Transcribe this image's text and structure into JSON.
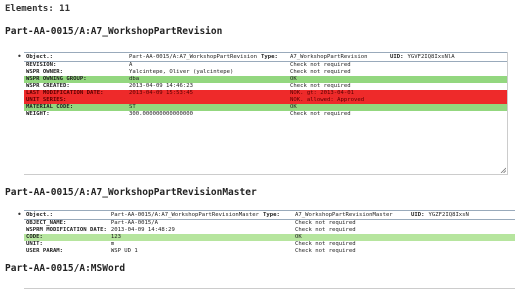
{
  "header": {
    "elements_label": "Elements: 11"
  },
  "sections": [
    {
      "title": "Part-AA-0015/A:A7_WorkshopPartRevision",
      "header_row": {
        "key": "Object.:",
        "value": "Part-AA-0015/A:A7_WorkshopPartRevision",
        "type_label": "Type:",
        "type_value": "A7_WorkshopPartRevision",
        "uid_label": "UID:",
        "uid_value": "YGVF2IQ8IxsNlA"
      },
      "rows": [
        {
          "key": "REVISION:",
          "value": "A",
          "status": "Check not required",
          "color": ""
        },
        {
          "key": "WSPR OWNER:",
          "value": "Yalcintepe, Oliver (yalcintepe)",
          "status": "Check not required",
          "color": ""
        },
        {
          "key": "WSPR OWNING GROUP:",
          "value": "dba",
          "status": "OK",
          "color": "green"
        },
        {
          "key": "WSPR CREATED:",
          "value": "2013-04-09 14:46:23",
          "status": "Check not required",
          "color": ""
        },
        {
          "key": "LAST MODIFICATION DATE:",
          "value": "2013-04-09 15:53:45",
          "status": "NOK. gt: 2013-04-01",
          "color": "red"
        },
        {
          "key": "UNIT SERIES:",
          "value": "",
          "status": "NOK. allowed: Approved",
          "color": "red"
        },
        {
          "key": "MATERIAL CODE:",
          "value": "ST",
          "status": "OK",
          "color": "green"
        },
        {
          "key": "WEIGHT:",
          "value": "300.000000000000000",
          "status": "Check not required",
          "color": ""
        }
      ]
    },
    {
      "title": "Part-AA-0015/A:A7_WorkshopPartRevisionMaster",
      "header_row": {
        "key": "Object.:",
        "value": "Part-AA-0015/A:A7_WorkshopPartRevisionMaster",
        "type_label": "Type:",
        "type_value": "A7_WorkshopPartRevisionMaster",
        "uid_label": "UID:",
        "uid_value": "YGZF2IQ8IxsN"
      },
      "rows": [
        {
          "key": "object_name:",
          "value": "Part-AA-0015/A",
          "status": "Check not required",
          "color": ""
        },
        {
          "key": "WSPRM MODIFICATION DATE:",
          "value": "2013-04-09 14:48:29",
          "status": "Check not required",
          "color": ""
        },
        {
          "key": "CODE:",
          "value": "123",
          "status": "OK",
          "color": "lightgreen"
        },
        {
          "key": "UNIT:",
          "value": "m",
          "status": "Check not required",
          "color": ""
        },
        {
          "key": "USER PARAM:",
          "value": "WSP UD 1",
          "status": "Check not required",
          "color": ""
        }
      ]
    },
    {
      "title": "Part-AA-0015/A:MSWord"
    }
  ],
  "colors": {
    "ok": "#93d77f",
    "nok": "#ee2a2a",
    "ok_light": "#b6e59e"
  },
  "icons": {
    "bullet": "bullet-icon",
    "resize": "resize-grip-icon"
  }
}
